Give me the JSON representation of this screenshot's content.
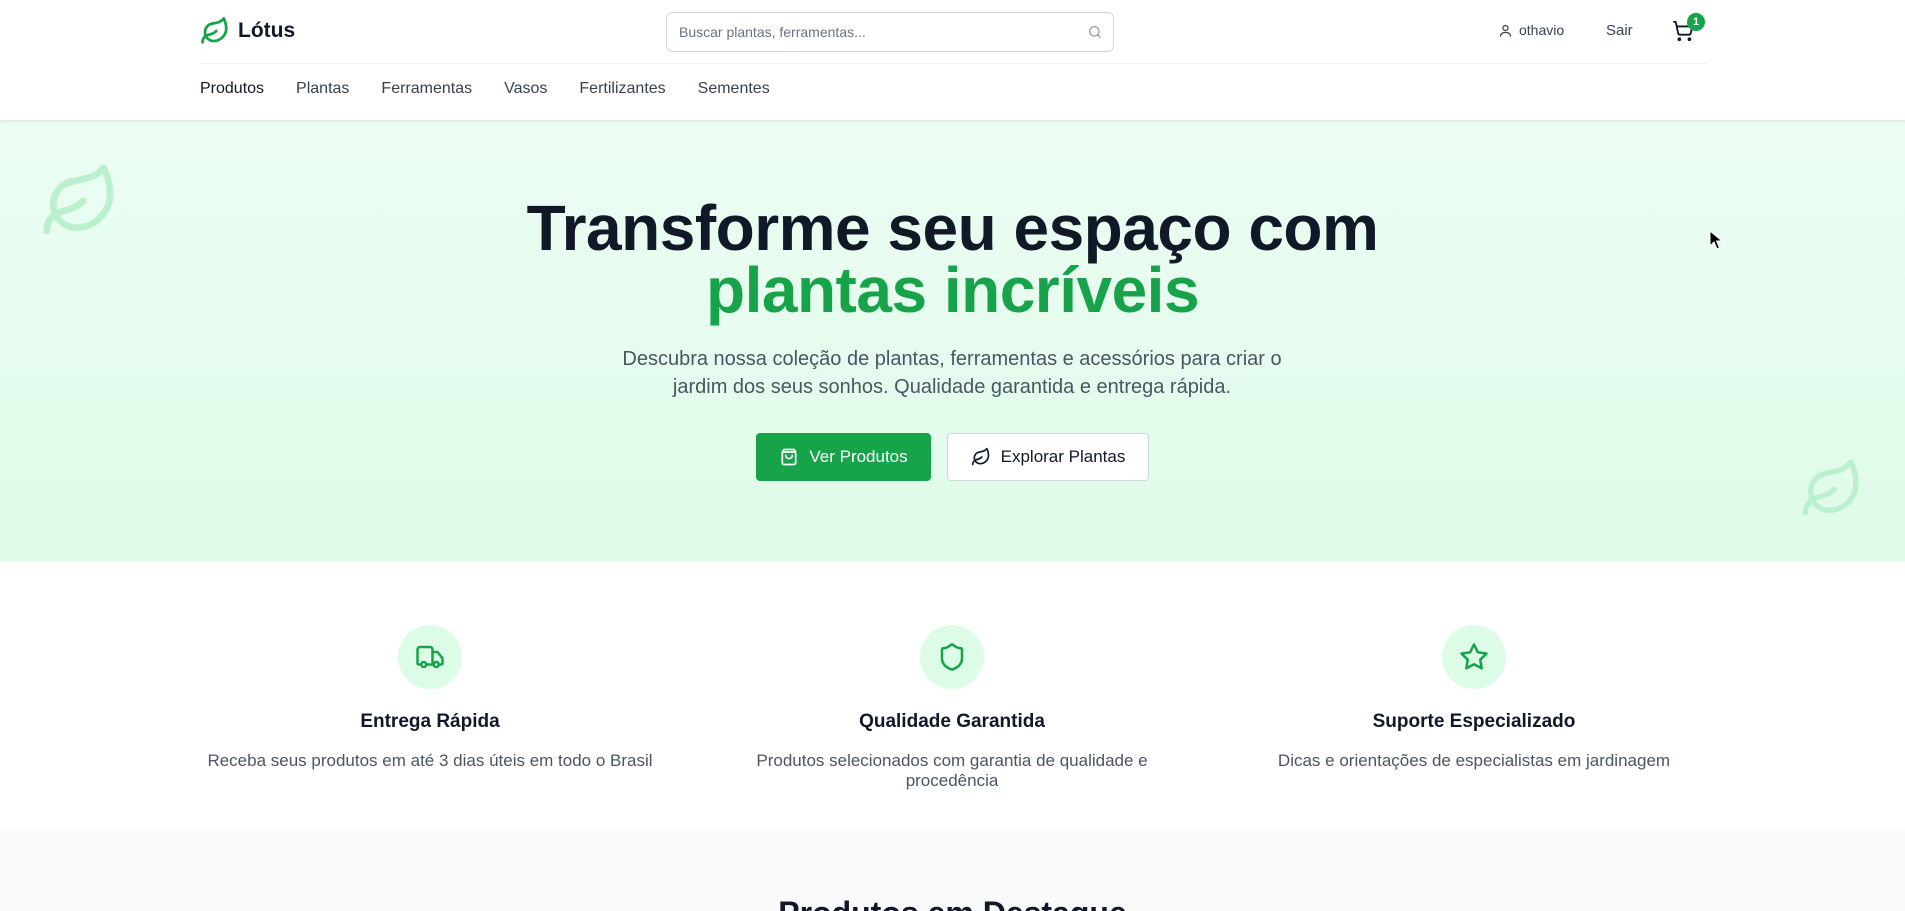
{
  "brand": {
    "name": "Lótus",
    "logo_icon": "leaf-icon",
    "accent_color": "#16a34a"
  },
  "search": {
    "placeholder": "Buscar plantas, ferramentas...",
    "value": ""
  },
  "user": {
    "name": "othavio",
    "logout_label": "Sair",
    "cart_count": "1"
  },
  "nav": {
    "items": [
      {
        "label": "Produtos",
        "active": true
      },
      {
        "label": "Plantas"
      },
      {
        "label": "Ferramentas"
      },
      {
        "label": "Vasos"
      },
      {
        "label": "Fertilizantes"
      },
      {
        "label": "Sementes"
      }
    ]
  },
  "hero": {
    "title_line1": "Transforme seu espaço com",
    "title_line2": "plantas incríveis",
    "subtitle": "Descubra nossa coleção de plantas, ferramentas e acessórios para criar o jardim dos seus sonhos. Qualidade garantida e entrega rápida.",
    "primary_button": "Ver Produtos",
    "secondary_button": "Explorar Plantas"
  },
  "features": [
    {
      "icon": "truck-icon",
      "title": "Entrega Rápida",
      "description": "Receba seus produtos em até 3 dias úteis em todo o Brasil"
    },
    {
      "icon": "shield-icon",
      "title": "Qualidade Garantida",
      "description": "Produtos selecionados com garantia de qualidade e procedência"
    },
    {
      "icon": "star-icon",
      "title": "Suporte Especializado",
      "description": "Dicas e orientações de especialistas em jardinagem"
    }
  ],
  "featured": {
    "title": "Produtos em Destaque"
  }
}
